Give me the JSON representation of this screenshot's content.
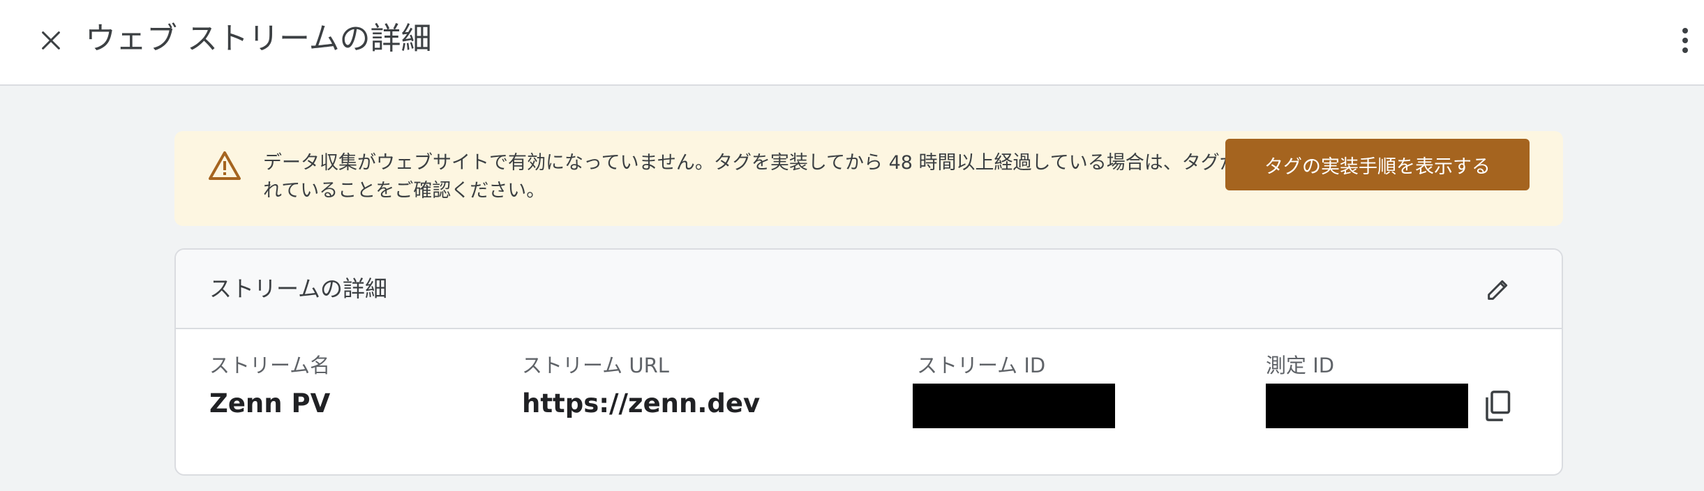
{
  "header": {
    "title": "ウェブ ストリームの詳細",
    "close_icon": "close-icon",
    "more_icon": "more-vert-icon"
  },
  "banner": {
    "message": "データ収集がウェブサイトで有効になっていません。タグを実装してから 48 時間以上経過している場合は、タグが適切に設定されていることをご確認ください。",
    "button_label": "タグの実装手順を表示する",
    "icon": "warning-icon",
    "accent_color": "#a5641f",
    "background_color": "#fdf6e1"
  },
  "stream_details": {
    "title": "ストリームの詳細",
    "edit_icon": "edit-icon",
    "fields": {
      "name": {
        "label": "ストリーム名",
        "value": "Zenn PV"
      },
      "url": {
        "label": "ストリーム URL",
        "value": "https://zenn.dev"
      },
      "stream_id": {
        "label": "ストリーム ID",
        "value": ""
      },
      "measurement_id": {
        "label": "測定 ID",
        "value": ""
      }
    },
    "copy_icon": "copy-icon"
  }
}
